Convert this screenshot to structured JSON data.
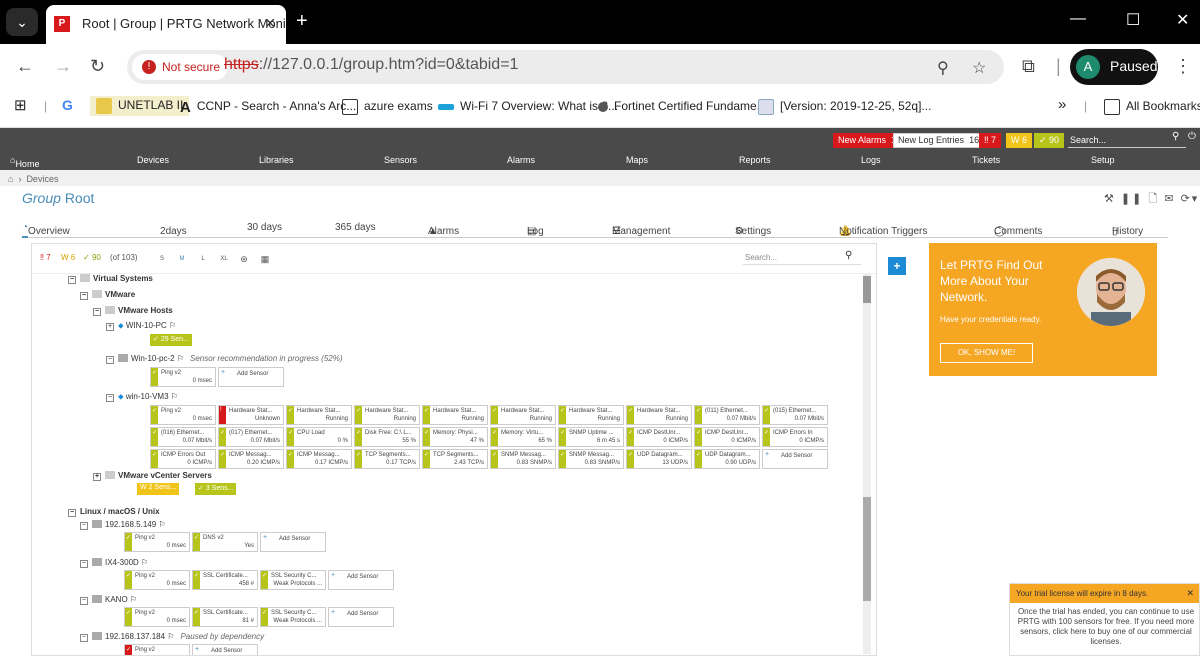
{
  "browser": {
    "tab_title": "Root | Group | PRTG Network Monitor (SN",
    "not_secure": "Not secure",
    "url_scheme": "https",
    "url_rest": "://127.0.0.1/group.htm?id=0&tabid=1",
    "profile_initial": "A",
    "profile_label": "Paused",
    "bookmarks": [
      "UNETLAB II",
      "CCNP - Search - Anna's Arc...",
      "azure exams",
      "Wi-Fi 7 Overview: What is 8...",
      "Fortinet Certified Fundame...",
      "[Version: 2019-12-25, 52q]...",
      "All Bookmarks"
    ],
    "bookmark_g": "G",
    "bookmark_a": "A",
    "more_chevron": "»"
  },
  "prtg": {
    "new_alarms_label": "New Alarms",
    "new_alarms_count": "1",
    "new_log_label": "New Log Entries",
    "new_log_count": "162",
    "red_count": "7",
    "yellow_count": "6",
    "green_count": "90",
    "search_placeholder": "Search...",
    "nav": [
      "Home",
      "Devices",
      "Libraries",
      "Sensors",
      "Alarms",
      "Maps",
      "Reports",
      "Logs",
      "Tickets",
      "Setup"
    ],
    "breadcrumb": "Devices",
    "title_prefix": "Group",
    "title_name": "Root",
    "tabs": [
      "Overview",
      "2",
      "days",
      "30 days",
      "365 days",
      "Alarms",
      "Log",
      "Management",
      "Settings",
      "Notification Triggers",
      "Comments",
      "History"
    ]
  },
  "panel": {
    "stat_red": "7",
    "stat_yellow": "6",
    "stat_green": "90",
    "stat_total": "(of 103)",
    "sizes": [
      "S",
      "M",
      "L",
      "XL"
    ],
    "search_placeholder": "Search..."
  },
  "tree": {
    "virtual_systems": "Virtual Systems",
    "vmware": "VMware",
    "vmware_hosts": "VMware Hosts",
    "win10pc": "WIN-10-PC",
    "win10pc_chip": "29 Sen...",
    "win10pc2": "Win-10-pc-2",
    "win10pc2_note": "Sensor recommendation in progress (52%)",
    "win10vm3": "win-10-VM3",
    "vcenter": "VMware vCenter Servers",
    "vcenter_chip1": "2 Sens...",
    "vcenter_chip2": "3 Sens...",
    "linux": "Linux / macOS / Unix",
    "host1": "192.168.5.149",
    "host2": "IX4-300D",
    "host3": "KANO",
    "host4": "192.168.137.184",
    "host4_note": "Paused by dependency",
    "add_sensor": "Add Sensor"
  },
  "sensors_pc2": [
    {
      "name": "Ping v2",
      "value": "0 msec"
    }
  ],
  "sensors_vm3": [
    {
      "name": "Ping v2",
      "value": "0 msec",
      "status": "up"
    },
    {
      "name": "Hardware Stat...",
      "value": "Unknown",
      "status": "down"
    },
    {
      "name": "Hardware Stat...",
      "value": "Running",
      "status": "up"
    },
    {
      "name": "Hardware Stat...",
      "value": "Running",
      "status": "up"
    },
    {
      "name": "Hardware Stat...",
      "value": "Running",
      "status": "up"
    },
    {
      "name": "Hardware Stat...",
      "value": "Running",
      "status": "up"
    },
    {
      "name": "Hardware Stat...",
      "value": "Running",
      "status": "up"
    },
    {
      "name": "Hardware Stat...",
      "value": "Running",
      "status": "up"
    },
    {
      "name": "(011) Ethernet...",
      "value": "0.07 Mbit/s",
      "status": "up"
    },
    {
      "name": "(015) Ethernet...",
      "value": "0.07 Mbit/s",
      "status": "up"
    },
    {
      "name": "(016) Ethernet...",
      "value": "0.07 Mbit/s",
      "status": "up"
    },
    {
      "name": "(017) Ethernet...",
      "value": "0.07 Mbit/s",
      "status": "up"
    },
    {
      "name": "CPU Load",
      "value": "0 %",
      "status": "up"
    },
    {
      "name": "Disk Free: C:\\ L...",
      "value": "55 %",
      "status": "up"
    },
    {
      "name": "Memory: Physi...",
      "value": "47 %",
      "status": "up"
    },
    {
      "name": "Memory: Virtu...",
      "value": "65 %",
      "status": "up"
    },
    {
      "name": "SNMP Uptime ...",
      "value": "6 m 45 s",
      "status": "up"
    },
    {
      "name": "ICMP DestUnr...",
      "value": "0 ICMP/s",
      "status": "up"
    },
    {
      "name": "ICMP DestUnr...",
      "value": "0 ICMP/s",
      "status": "up"
    },
    {
      "name": "ICMP Errors In",
      "value": "0 ICMP/s",
      "status": "up"
    },
    {
      "name": "ICMP Errors Out",
      "value": "0 ICMP/s",
      "status": "up"
    },
    {
      "name": "ICMP Messag...",
      "value": "0.20 ICMP/s",
      "status": "up"
    },
    {
      "name": "ICMP Messag...",
      "value": "0.17 ICMP/s",
      "status": "up"
    },
    {
      "name": "TCP Segments...",
      "value": "0.17 TCP/s",
      "status": "up"
    },
    {
      "name": "TCP Segments...",
      "value": "2.43 TCP/s",
      "status": "up"
    },
    {
      "name": "SNMP Messag...",
      "value": "0.83 SNMP/s",
      "status": "up"
    },
    {
      "name": "SNMP Messag...",
      "value": "0.83 SNMP/s",
      "status": "up"
    },
    {
      "name": "UDP Datagram...",
      "value": "13 UDP/s",
      "status": "up"
    },
    {
      "name": "UDP Datagram...",
      "value": "0.90 UDP/s",
      "status": "up"
    }
  ],
  "sensors_host1": [
    {
      "name": "Ping v2",
      "value": "0 msec"
    },
    {
      "name": "DNS v2",
      "value": "Yes"
    }
  ],
  "sensors_host2": [
    {
      "name": "Ping v2",
      "value": "0 msec"
    },
    {
      "name": "SSL Certificate...",
      "value": "458 #"
    },
    {
      "name": "SSL Security C...",
      "value": "Weak Protocols ..."
    }
  ],
  "sensors_host3": [
    {
      "name": "Ping v2",
      "value": "0 msec"
    },
    {
      "name": "SSL Certificate...",
      "value": "81 #"
    },
    {
      "name": "SSL Security C...",
      "value": "Weak Protocols ..."
    }
  ],
  "sensors_host4": [
    {
      "name": "Ping v2",
      "value": ""
    }
  ],
  "promo": {
    "heading": "Let PRTG Find Out More About Your Network.",
    "sub": "Have your credentials ready.",
    "button": "OK, SHOW ME!"
  },
  "trial": {
    "heading": "Your trial license will expire in 8 days.",
    "body": "Once the trial has ended, you can continue to use PRTG with 100 sensors for free. If you need more sensors, click here to buy one of our commercial licenses."
  },
  "colors": {
    "green": "#b7c41a",
    "red": "#d7191c",
    "yellow": "#f0c419",
    "blue": "#4a8db8"
  }
}
